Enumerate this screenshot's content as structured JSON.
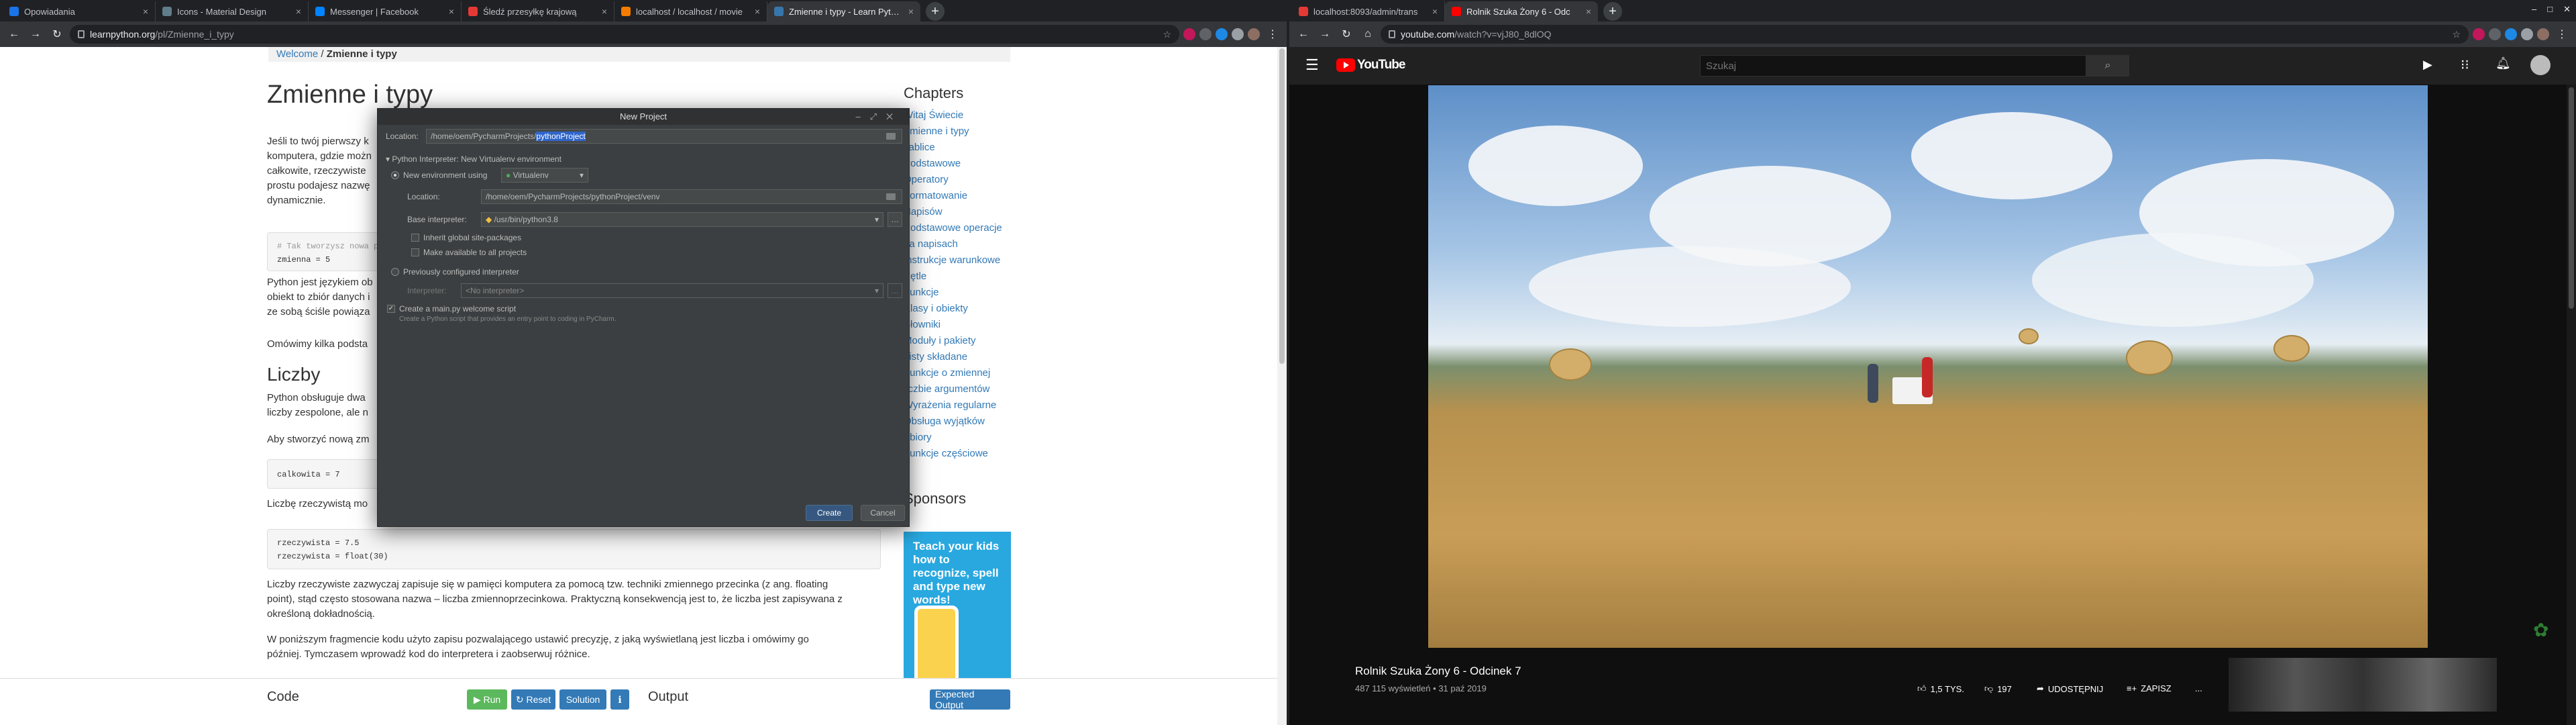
{
  "left_browser": {
    "tabs": [
      {
        "title": "Opowiadania",
        "color": "#1a73e8"
      },
      {
        "title": "Icons - Material Design",
        "color": "#607d8b"
      },
      {
        "title": "Messenger | Facebook",
        "color": "#0084ff"
      },
      {
        "title": "Śledź przesyłkę krajową",
        "color": "#e53935"
      },
      {
        "title": "localhost / localhost / movie",
        "color": "#f57c00"
      },
      {
        "title": "Zmienne i typy - Learn Python",
        "color": "#3776ab"
      }
    ],
    "new_tab": "+",
    "url_domain": "learnpython.org",
    "url_path": "/pl/Zmienne_i_typy"
  },
  "learnpython": {
    "breadcrumb_link": "Welcome",
    "breadcrumb_sep": " / ",
    "breadcrumb_current": "Zmienne i typy",
    "title": "Zmienne i typy",
    "intro_lines": [
      "Jeśli to twój pierwszy k",
      "komputera, gdzie możn",
      "całkowite, rzeczywiste",
      "prostu podajesz nazwę",
      "dynamicznie."
    ],
    "code1_line1": "# Tak tworzysz nowa p",
    "code1_line2": "zmienna = 5",
    "para2_lines": [
      "Python jest językiem ob",
      "obiekt to zbiór danych i",
      "ze sobą ściśle powiąza"
    ],
    "para3": "Omówimy kilka podsta",
    "numbers_heading": "Liczby",
    "numbers_text_lines": [
      "Python obsługuje dwa",
      "liczby zespolone, ale n"
    ],
    "create_int_text": "Aby stworzyć nową zm",
    "code2": "calkowita = 7",
    "real_text": "Liczbę rzeczywistą mo",
    "code3_line1": "rzeczywista = 7.5",
    "code3_line2": "rzeczywista = float(30)",
    "para_float_1": "Liczby rzeczywiste zazwyczaj zapisuje się w pamięci komputera za pomocą tzw. techniki zmiennego przecinka (z ang. floating",
    "para_float_2": "point), stąd często stosowana nazwa – liczba zmiennoprzecinkowa. Praktyczną konsekwencją jest to, że liczba jest zapisywana z",
    "para_float_3": "określoną dokładnością.",
    "para_last_1": "W poniższym fragmencie kodu użyto zapisu pozwalającego ustawić precyzję, z jaką wyświetlaną jest liczba i omówimy go",
    "para_last_2": "później. Tymczasem wprowadź kod do interpretera i zaobserwuj różnice.",
    "chapters_title": "Chapters",
    "chapters": [
      "Witaj Świecie",
      "Zmienne i typy",
      "Tablice",
      "Podstawowe",
      "Operatory",
      "Formatowanie",
      "Napisów",
      "Podstawowe operacje",
      "na napisach",
      "Instrukcje warunkowe",
      "Pętle",
      "Funkcje",
      "Klasy i obiekty",
      "Słowniki",
      "Moduły i pakiety",
      "Listy składane",
      "Funkcje o zmiennej",
      "liczbie argumentów",
      "Wyrażenia regularne",
      "Obsługa wyjątków",
      "Zbiory",
      "Funkcje częściowe"
    ],
    "sponsors_title": "Sponsors",
    "ad_text": "Teach your kids how to recognize, spell and type new words!",
    "bottom": {
      "code_label": "Code",
      "run": "Run",
      "reset": "Reset",
      "solution": "Solution",
      "output_label": "Output",
      "expected_output": "Expected Output"
    }
  },
  "dialog": {
    "title": "New Project",
    "location_label": "Location:",
    "location_prefix": "/home/oem/PycharmProjects/",
    "location_selected": "pythonProject",
    "interpreter_section": "Python Interpreter: New Virtualenv environment",
    "new_env_label": "New environment using",
    "env_tool": "Virtualenv",
    "env_location_label": "Location:",
    "env_location": "/home/oem/PycharmProjects/pythonProject/venv",
    "base_interp_label": "Base interpreter:",
    "base_interp": "/usr/bin/python3.8",
    "inherit_label": "Inherit global site-packages",
    "available_label": "Make available to all projects",
    "prev_configured_label": "Previously configured interpreter",
    "interp_label": "Interpreter:",
    "interp_value": "<No interpreter>",
    "main_py_label": "Create a main.py welcome script",
    "main_py_desc": "Create a Python script that provides an entry point to coding in PyCharm.",
    "create": "Create",
    "cancel": "Cancel"
  },
  "right_browser": {
    "tabs": [
      {
        "title": "localhost:8093/admin/trans",
        "color": "#e53935"
      },
      {
        "title": "Rolnik Szuka Żony 6 - Odc",
        "color": "#ff0000"
      }
    ],
    "new_tab": "+",
    "url_domain": "youtube.com",
    "url_path": "/watch?v=vjJ80_8dlOQ"
  },
  "youtube": {
    "logo": "YouTube",
    "search_placeholder": "Szukaj",
    "video_title": "Rolnik Szuka Żony 6 - Odcinek 7",
    "views": "487 115 wyświetleń",
    "dot": "•",
    "date": "31 paź 2019",
    "likes": "1,5 TYS.",
    "dislikes": "197",
    "share": "UDOSTĘPNIJ",
    "save": "ZAPISZ",
    "more": "..."
  }
}
